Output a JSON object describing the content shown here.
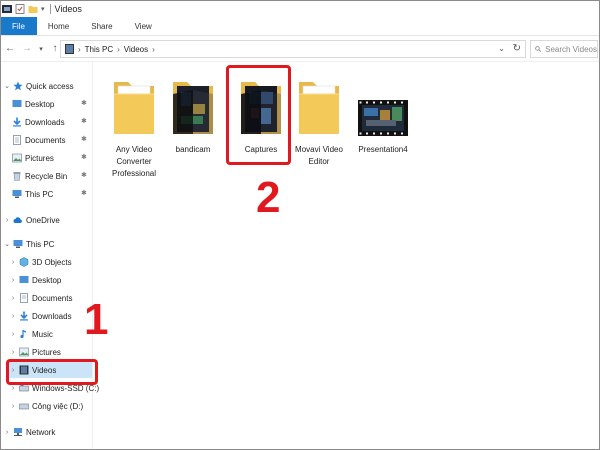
{
  "titlebar": {
    "title": "Videos"
  },
  "ribbon": {
    "tabs": [
      "File",
      "Home",
      "Share",
      "View"
    ]
  },
  "address": {
    "crumbs": [
      "This PC",
      "Videos"
    ],
    "search_placeholder": "Search Videos"
  },
  "navpane": {
    "quick_access": "Quick access",
    "quick_items": [
      "Desktop",
      "Downloads",
      "Documents",
      "Pictures",
      "Recycle Bin",
      "This PC"
    ],
    "onedrive": "OneDrive",
    "this_pc": "This PC",
    "pc_items": [
      "3D Objects",
      "Desktop",
      "Documents",
      "Downloads",
      "Music",
      "Pictures",
      "Videos",
      "Windows-SSD (C:)",
      "Công việc (D:)"
    ],
    "network": "Network"
  },
  "files": [
    {
      "name": "Any Video Converter Professional",
      "type": "folder"
    },
    {
      "name": "bandicam",
      "type": "folder-dark"
    },
    {
      "name": "Captures",
      "type": "folder-dark"
    },
    {
      "name": "Movavi Video Editor",
      "type": "folder"
    },
    {
      "name": "Presentation4",
      "type": "video"
    }
  ],
  "annotations": {
    "step1": "1",
    "step2": "2",
    "color": "#e1191f"
  },
  "colors": {
    "accent": "#1979ca",
    "selection": "#cce4f7",
    "folder": "#f3c95a"
  }
}
